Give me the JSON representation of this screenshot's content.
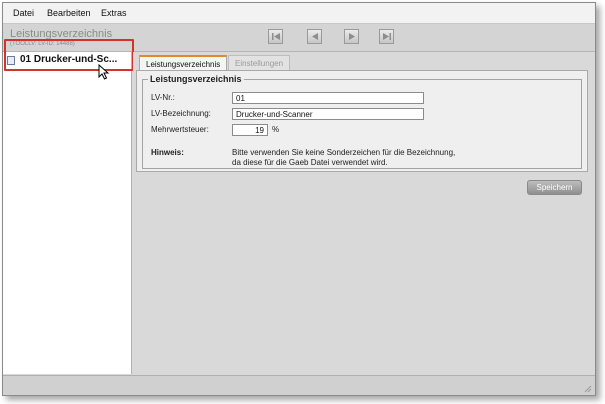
{
  "menu": {
    "items": [
      "Datei",
      "Bearbeiten",
      "Extras"
    ]
  },
  "header": {
    "title": "Leistungsverzeichnis",
    "subtitle": "(TOOLLV: LV-ID: 14488)"
  },
  "nav": {
    "buttons": [
      "first-icon",
      "prev-icon",
      "next-icon",
      "last-icon"
    ]
  },
  "sidebar": {
    "items": [
      {
        "label": "01 Drucker-und-Sc...",
        "icon": "document-icon"
      }
    ]
  },
  "tabs": [
    {
      "label": "Leistungsverzeichnis",
      "active": true
    },
    {
      "label": "Einstellungen",
      "active": false
    }
  ],
  "form": {
    "legend": "Leistungsverzeichnis",
    "lv_nr_label": "LV-Nr.:",
    "lv_nr_value": "01",
    "lv_bez_label": "LV-Bezeichnung:",
    "lv_bez_value": "Drucker-und-Scanner",
    "mwst_label": "Mehrwertsteuer:",
    "mwst_value": "19",
    "mwst_unit": "%",
    "hint_label": "Hinweis:",
    "hint_line1": "Bitte verwenden Sie keine Sonderzeichen für die Bezeichnung,",
    "hint_line2": "da diese für die Gaeb Datei verwendet wird."
  },
  "actions": {
    "save_label": "Speichern"
  },
  "colors": {
    "highlight": "#d2332c",
    "active_tab_accent": "#e08a2a"
  }
}
